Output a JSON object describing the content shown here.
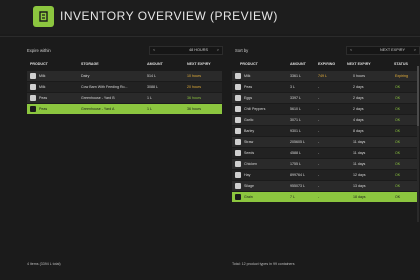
{
  "header": {
    "title": "INVENTORY OVERVIEW (PREVIEW)",
    "icon": "inventory-icon"
  },
  "left": {
    "label": "Expire within",
    "select": {
      "prev": "<",
      "value": "48 HOURS",
      "next": ">"
    },
    "columns": [
      "PRODUCT",
      "STORAGE",
      "AMOUNT",
      "NEXT EXPIRY"
    ],
    "rows": [
      {
        "icon": "milk-can-icon",
        "product": "Milk",
        "storage": "Dairy",
        "amount": "514 L",
        "expiry": "10 hours",
        "status": "warn",
        "highlight": false
      },
      {
        "icon": "milk-can-icon",
        "product": "Milk",
        "storage": "Cow Barn With Feeding Ro...",
        "amount": "3088 L",
        "expiry": "20 hours",
        "status": "warn",
        "highlight": false
      },
      {
        "icon": "peas-icon",
        "product": "Peas",
        "storage": "Greenhouse - Yard B",
        "amount": "1 L",
        "expiry": "36 hours",
        "status": "ok",
        "highlight": false
      },
      {
        "icon": "peas-icon",
        "product": "Peas",
        "storage": "Greenhouse - Yard A",
        "amount": "1 L",
        "expiry": "36 hours",
        "status": "ok",
        "highlight": true
      }
    ],
    "footer": "4 items (3394 L total)"
  },
  "right": {
    "label": "Sort by",
    "select": {
      "prev": "<",
      "value": "NEXT EXPIRY",
      "next": ">"
    },
    "columns": [
      "PRODUCT",
      "AMOUNT",
      "EXPIRING",
      "NEXT EXPIRY",
      "STATUS"
    ],
    "rows": [
      {
        "icon": "milk-can-icon",
        "product": "Milk",
        "amount": "3361 L",
        "expiring": "749 L",
        "expiry": "0 hours",
        "status": "Expiring",
        "cls": "warn",
        "highlight": false
      },
      {
        "icon": "peas-icon",
        "product": "Peas",
        "amount": "3 L",
        "expiring": "-",
        "expiry": "2 days",
        "status": "OK",
        "cls": "ok",
        "highlight": false
      },
      {
        "icon": "eggs-icon",
        "product": "Eggs",
        "amount": "3397 L",
        "expiring": "-",
        "expiry": "2 days",
        "status": "OK",
        "cls": "ok",
        "highlight": false
      },
      {
        "icon": "chili-icon",
        "product": "Chili Peppers",
        "amount": "5610 L",
        "expiring": "-",
        "expiry": "2 days",
        "status": "OK",
        "cls": "ok",
        "highlight": false
      },
      {
        "icon": "garlic-icon",
        "product": "Garlic",
        "amount": "3071 L",
        "expiry": "4 days",
        "expiring": "-",
        "status": "OK",
        "cls": "ok",
        "highlight": false
      },
      {
        "icon": "barley-icon",
        "product": "Barley",
        "amount": "9301 L",
        "expiring": "-",
        "expiry": "8 days",
        "status": "OK",
        "cls": "ok",
        "highlight": false
      },
      {
        "icon": "straw-icon",
        "product": "Straw",
        "amount": "205605 L",
        "expiring": "-",
        "expiry": "11 days",
        "status": "OK",
        "cls": "ok",
        "highlight": false
      },
      {
        "icon": "seeds-icon",
        "product": "Seeds",
        "amount": "4588 L",
        "expiring": "-",
        "expiry": "11 days",
        "status": "OK",
        "cls": "ok",
        "highlight": false
      },
      {
        "icon": "chicken-icon",
        "product": "Chicken",
        "amount": "1755 L",
        "expiring": "-",
        "expiry": "11 days",
        "status": "OK",
        "cls": "ok",
        "highlight": false
      },
      {
        "icon": "hay-icon",
        "product": "Hay",
        "amount": "899764 L",
        "expiring": "-",
        "expiry": "12 days",
        "status": "OK",
        "cls": "ok",
        "highlight": false
      },
      {
        "icon": "silage-icon",
        "product": "Silage",
        "amount": "955073 L",
        "expiring": "-",
        "expiry": "13 days",
        "status": "OK",
        "cls": "ok",
        "highlight": false
      },
      {
        "icon": "grain-icon",
        "product": "Grain",
        "amount": "7 L",
        "expiring": "-",
        "expiry": "18 days",
        "status": "OK",
        "cls": "ok",
        "highlight": true
      }
    ],
    "footer": "Total: 12 product types in 99 containers"
  },
  "colors": {
    "accent": "#8cc63f",
    "warn": "#e8b13a",
    "bg": "#1b1b1b"
  }
}
